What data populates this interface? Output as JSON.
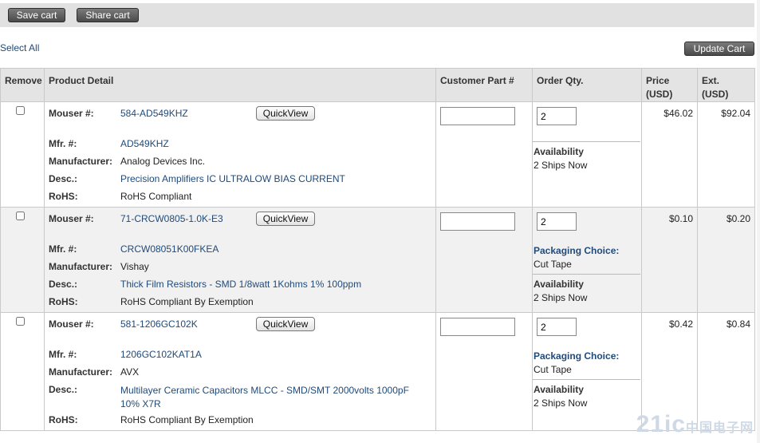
{
  "toolbar": {
    "save_label": "Save cart",
    "share_label": "Share cart",
    "select_all": "Select All",
    "update_label": "Update Cart"
  },
  "columns": {
    "remove": "Remove",
    "product_detail": "Product Detail",
    "customer_part": "Customer Part #",
    "order_qty": "Order Qty.",
    "price": "Price\n(USD)",
    "ext": "Ext.\n(USD)"
  },
  "labels": {
    "mouser": "Mouser #:",
    "mfr": "Mfr. #:",
    "manufacturer": "Manufacturer:",
    "desc": "Desc.:",
    "rohs": "RoHS:",
    "quickview": "QuickView",
    "availability": "Availability",
    "packaging": "Packaging Choice:"
  },
  "items": [
    {
      "mouser_no": "584-AD549KHZ",
      "mfr_no": "AD549KHZ",
      "manufacturer": "Analog Devices Inc.",
      "desc": "Precision Amplifiers IC ULTRALOW BIAS CURRENT",
      "rohs": "RoHS Compliant",
      "qty": "2",
      "availability": "2 Ships Now",
      "price": "$46.02",
      "ext": "$92.04"
    },
    {
      "mouser_no": "71-CRCW0805-1.0K-E3",
      "mfr_no": "CRCW08051K00FKEA",
      "manufacturer": "Vishay",
      "desc": "Thick Film Resistors - SMD 1/8watt 1Kohms 1% 100ppm",
      "rohs": "RoHS Compliant By Exemption",
      "qty": "2",
      "packaging": "Cut Tape",
      "availability": "2 Ships Now",
      "price": "$0.10",
      "ext": "$0.20"
    },
    {
      "mouser_no": "581-1206GC102K",
      "mfr_no": "1206GC102KAT1A",
      "manufacturer": "AVX",
      "desc": "Multilayer Ceramic Capacitors MLCC - SMD/SMT 2000volts 1000pF 10% X7R",
      "rohs": "RoHS Compliant By Exemption",
      "qty": "2",
      "packaging": "Cut Tape",
      "availability": "2 Ships Now",
      "price": "$0.42",
      "ext": "$0.84"
    }
  ],
  "watermark": {
    "main": "21ic",
    "sub": "中国电子网"
  }
}
